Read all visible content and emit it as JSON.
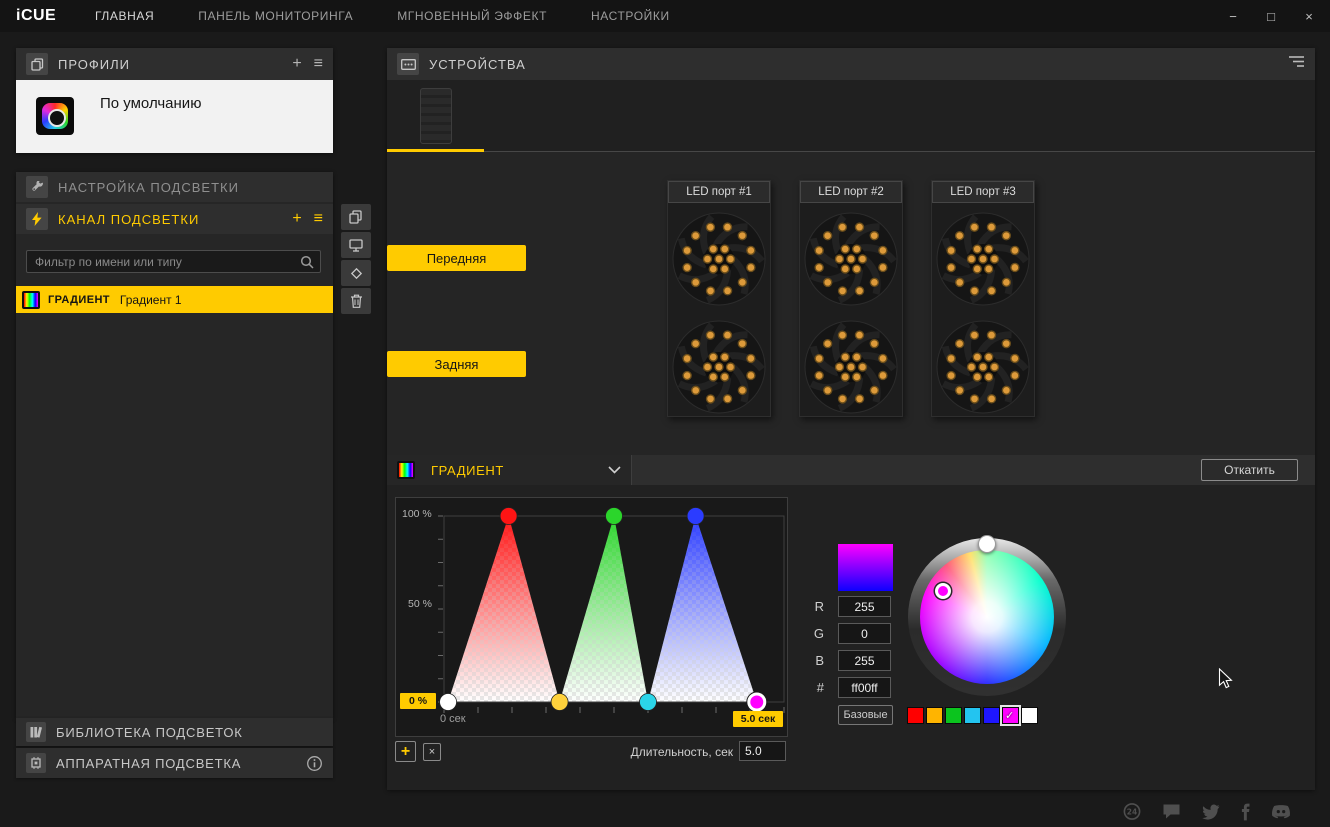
{
  "colors": {
    "accent": "#ffcb00"
  },
  "titlebar": {
    "logo": "iCUE",
    "menu": [
      {
        "label": "ГЛАВНАЯ"
      },
      {
        "label": "ПАНЕЛЬ МОНИТОРИНГА"
      },
      {
        "label": "МГНОВЕННЫЙ ЭФФЕКТ"
      },
      {
        "label": "НАСТРОЙКИ"
      }
    ],
    "window_controls": {
      "minimize": "−",
      "maximize": "□",
      "close": "×"
    }
  },
  "sidebar": {
    "profiles": {
      "title": "ПРОФИЛИ",
      "add": "+",
      "menu": "≡",
      "active_profile": "По умолчанию"
    },
    "lighting_setup": {
      "title": "НАСТРОЙКА ПОДСВЕТКИ"
    },
    "lighting_channel": {
      "title": "КАНАЛ ПОДСВЕТКИ",
      "add": "+",
      "menu": "≡",
      "filter_placeholder": "Фильтр по имени или типу",
      "selected_effect": {
        "type": "ГРАДИЕНТ",
        "name": "Градиент 1"
      }
    },
    "library": {
      "title": "БИБЛИОТЕКА ПОДСВЕТОК"
    },
    "hardware": {
      "title": "АППАРАТНАЯ ПОДСВЕТКА"
    }
  },
  "devices_panel": {
    "title": "УСТРОЙСТВА",
    "led_ports": [
      {
        "label": "LED порт #1"
      },
      {
        "label": "LED порт #2"
      },
      {
        "label": "LED порт #3"
      }
    ],
    "side_buttons": [
      {
        "label": "Передняя"
      },
      {
        "label": "Задняя"
      }
    ]
  },
  "effect_editor": {
    "type_selector": "ГРАДИЕНТ",
    "rollback": "Откатить",
    "axis": {
      "y100": "100 %",
      "y50": "50 %",
      "y0": "0 %",
      "x_start": "0 сек",
      "x_end": "5.0 сек"
    },
    "duration_label": "Длительность, сек",
    "duration_value": "5.0",
    "add_stop": "+",
    "remove_stop": "×"
  },
  "color_picker": {
    "preview_colors": [
      "#ff00ff",
      "#0d00ff"
    ],
    "channels": [
      {
        "label": "R",
        "value": "255"
      },
      {
        "label": "G",
        "value": "0"
      },
      {
        "label": "B",
        "value": "255"
      },
      {
        "label": "#",
        "value": "ff00ff"
      }
    ],
    "basic_button": "Базовые",
    "swatches": [
      "#ff0000",
      "#ffb400",
      "#0bc41e",
      "#23c4f0",
      "#1e16ff",
      "#ff00ff",
      "#ffffff"
    ],
    "selected_swatch": 5
  },
  "chart_data": {
    "type": "area",
    "title": "Gradient timeline (opacity % over time)",
    "x_range_sec": [
      0,
      5
    ],
    "y_range_pct": [
      0,
      100
    ],
    "stops": [
      {
        "t": 0.06,
        "pct": 0,
        "color": "#ffffff"
      },
      {
        "t": 0.95,
        "pct": 100,
        "color": "#ff1414"
      },
      {
        "t": 1.7,
        "pct": 0,
        "color": "#ffd23c"
      },
      {
        "t": 2.5,
        "pct": 100,
        "color": "#2bd52b"
      },
      {
        "t": 3.0,
        "pct": 0,
        "color": "#2bd5e8"
      },
      {
        "t": 3.7,
        "pct": 100,
        "color": "#2b3cff"
      },
      {
        "t": 4.6,
        "pct": 0,
        "color": "#ff00ff",
        "selected": true
      }
    ]
  },
  "footer": {
    "icons": [
      "support-24",
      "chat",
      "twitter",
      "facebook",
      "discord"
    ]
  }
}
